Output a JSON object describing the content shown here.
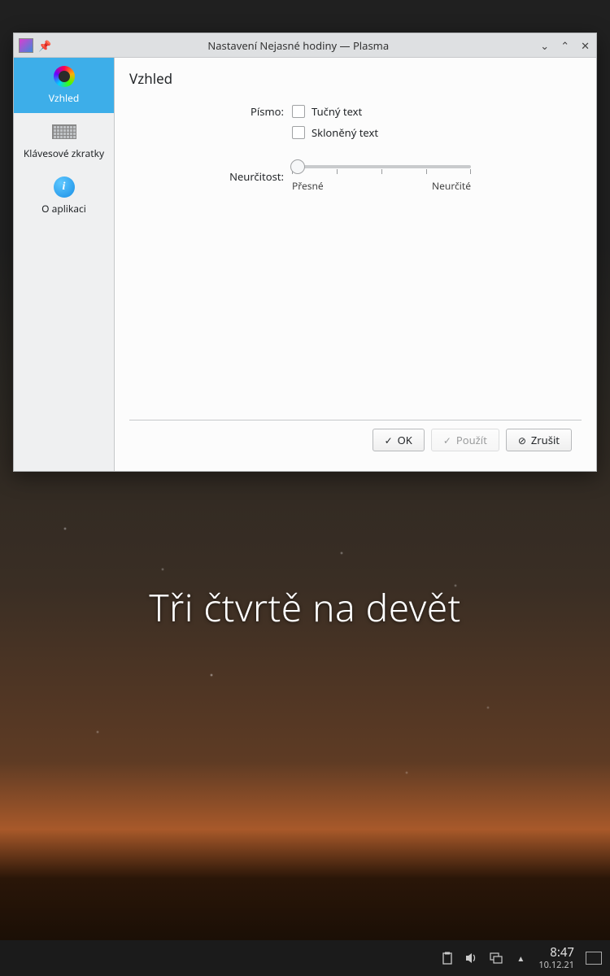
{
  "desktop": {
    "fuzzy_clock_text": "Tři čtvrtě na devět"
  },
  "taskbar": {
    "time": "8:47",
    "date": "10.12.21"
  },
  "window": {
    "title": "Nastavení Nejasné hodiny — Plasma",
    "sidebar": {
      "items": [
        {
          "label": "Vzhled"
        },
        {
          "label": "Klávesové zkratky"
        },
        {
          "label": "O aplikaci"
        }
      ]
    },
    "page": {
      "heading": "Vzhled",
      "font_label": "Písmo:",
      "bold_label": "Tučný text",
      "italic_label": "Skloněný text",
      "fuzziness_label": "Neurčitost:",
      "fuzziness_min": "Přesné",
      "fuzziness_max": "Neurčité"
    },
    "buttons": {
      "ok": "OK",
      "apply": "Použít",
      "cancel": "Zrušit"
    }
  }
}
